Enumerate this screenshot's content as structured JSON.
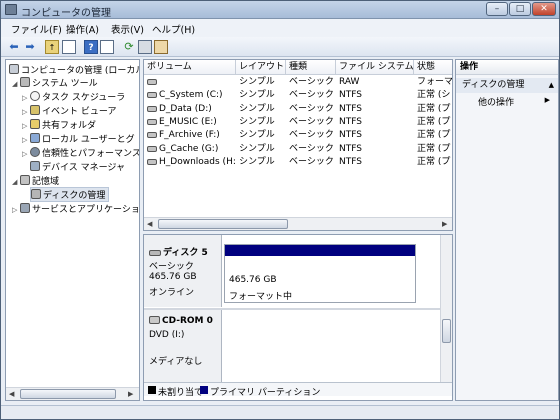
{
  "window": {
    "title": "コンピュータの管理",
    "min_glyph": "–",
    "max_glyph": "□",
    "close_glyph": "✕"
  },
  "menu": [
    "ファイル(F)",
    "操作(A)",
    "表示(V)",
    "ヘルプ(H)"
  ],
  "toolbar_icons": [
    "back-arrow-icon",
    "forward-arrow-icon",
    "up-folder-icon",
    "show-hide-tree-icon",
    "help-icon",
    "view-icon",
    "refresh-icon",
    "export-icon",
    "properties-icon"
  ],
  "tree": {
    "root": "コンピュータの管理 (ローカル)",
    "system_tools": "システム ツール",
    "task_scheduler": "タスク スケジューラ",
    "event_viewer": "イベント ビューア",
    "shared_folders": "共有フォルダ",
    "local_users": "ローカル ユーザーとグ",
    "reliability": "信頼性とパフォーマンス",
    "device_manager": "デバイス マネージャ",
    "storage": "記憶域",
    "disk_management": "ディスクの管理",
    "services_apps": "サービスとアプリケーショ"
  },
  "volume_table": {
    "columns": [
      "ボリューム",
      "レイアウト",
      "種類",
      "ファイル システム",
      "状態"
    ],
    "rows": [
      [
        "",
        "シンプル",
        "ベーシック",
        "RAW",
        "フォーマ"
      ],
      [
        "C_System (C:)",
        "シンプル",
        "ベーシック",
        "NTFS",
        "正常 (シ"
      ],
      [
        "D_Data (D:)",
        "シンプル",
        "ベーシック",
        "NTFS",
        "正常 (プ"
      ],
      [
        "E_MUSIC (E:)",
        "シンプル",
        "ベーシック",
        "NTFS",
        "正常 (プ"
      ],
      [
        "F_Archive (F:)",
        "シンプル",
        "ベーシック",
        "NTFS",
        "正常 (プ"
      ],
      [
        "G_Cache (G:)",
        "シンプル",
        "ベーシック",
        "NTFS",
        "正常 (プ"
      ],
      [
        "H_Downloads (H:)",
        "シンプル",
        "ベーシック",
        "NTFS",
        "正常 (プ"
      ]
    ]
  },
  "disks": {
    "disk5": {
      "name": "ディスク 5",
      "type": "ベーシック",
      "size": "465.76 GB",
      "status": "オンライン",
      "partition_size": "465.76 GB",
      "partition_status": "フォーマット中"
    },
    "cdrom0": {
      "name": "CD-ROM 0",
      "drive": "DVD (I:)",
      "media": "メディアなし"
    }
  },
  "legend": {
    "unallocated": "未割り当て",
    "primary": "プライマリ パーティション"
  },
  "colors": {
    "primary_partition": "#00007f",
    "unallocated": "#000000"
  },
  "operations": {
    "header": "操作",
    "section": "ディスクの管理",
    "more": "他の操作",
    "collapse_glyph": "▲",
    "more_glyph": "▶"
  }
}
